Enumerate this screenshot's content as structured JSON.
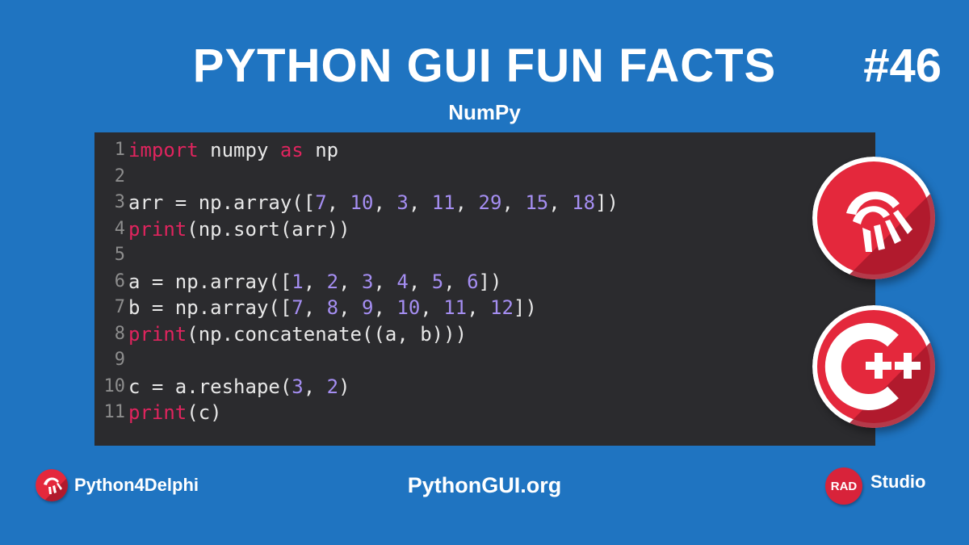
{
  "header": {
    "title": "PYTHON GUI FUN FACTS",
    "number": "#46",
    "subtitle": "NumPy"
  },
  "code": {
    "lines": [
      {
        "n": "1",
        "tokens": [
          [
            "kw",
            "import"
          ],
          [
            "t",
            " numpy "
          ],
          [
            "kw",
            "as"
          ],
          [
            "t",
            " np"
          ]
        ]
      },
      {
        "n": "2",
        "tokens": []
      },
      {
        "n": "3",
        "tokens": [
          [
            "t",
            "arr = np.array(["
          ],
          [
            "num",
            "7"
          ],
          [
            "t",
            ", "
          ],
          [
            "num",
            "10"
          ],
          [
            "t",
            ", "
          ],
          [
            "num",
            "3"
          ],
          [
            "t",
            ", "
          ],
          [
            "num",
            "11"
          ],
          [
            "t",
            ", "
          ],
          [
            "num",
            "29"
          ],
          [
            "t",
            ", "
          ],
          [
            "num",
            "15"
          ],
          [
            "t",
            ", "
          ],
          [
            "num",
            "18"
          ],
          [
            "t",
            "])"
          ]
        ]
      },
      {
        "n": "4",
        "tokens": [
          [
            "kw",
            "print"
          ],
          [
            "t",
            "(np.sort(arr))"
          ]
        ]
      },
      {
        "n": "5",
        "tokens": []
      },
      {
        "n": "6",
        "tokens": [
          [
            "t",
            "a = np.array(["
          ],
          [
            "num",
            "1"
          ],
          [
            "t",
            ", "
          ],
          [
            "num",
            "2"
          ],
          [
            "t",
            ", "
          ],
          [
            "num",
            "3"
          ],
          [
            "t",
            ", "
          ],
          [
            "num",
            "4"
          ],
          [
            "t",
            ", "
          ],
          [
            "num",
            "5"
          ],
          [
            "t",
            ", "
          ],
          [
            "num",
            "6"
          ],
          [
            "t",
            "])"
          ]
        ]
      },
      {
        "n": "7",
        "tokens": [
          [
            "t",
            "b = np.array(["
          ],
          [
            "num",
            "7"
          ],
          [
            "t",
            ", "
          ],
          [
            "num",
            "8"
          ],
          [
            "t",
            ", "
          ],
          [
            "num",
            "9"
          ],
          [
            "t",
            ", "
          ],
          [
            "num",
            "10"
          ],
          [
            "t",
            ", "
          ],
          [
            "num",
            "11"
          ],
          [
            "t",
            ", "
          ],
          [
            "num",
            "12"
          ],
          [
            "t",
            "])"
          ]
        ]
      },
      {
        "n": "8",
        "tokens": [
          [
            "kw",
            "print"
          ],
          [
            "t",
            "(np.concatenate((a, b)))"
          ]
        ]
      },
      {
        "n": "9",
        "tokens": []
      },
      {
        "n": "10",
        "tokens": [
          [
            "t",
            "c = a.reshape("
          ],
          [
            "num",
            "3"
          ],
          [
            "t",
            ", "
          ],
          [
            "num",
            "2"
          ],
          [
            "t",
            ")"
          ]
        ]
      },
      {
        "n": "11",
        "tokens": [
          [
            "kw",
            "print"
          ],
          [
            "t",
            "(c)"
          ]
        ]
      }
    ]
  },
  "logos": {
    "delphi": "delphi-helmet-icon",
    "cpp": "cpp-builder-icon"
  },
  "footer": {
    "left_label": "Python4Delphi",
    "center_label": "PythonGUI.org",
    "rad_badge": "RAD",
    "right_label": "Studio"
  },
  "colors": {
    "background": "#1f74c1",
    "code_bg": "#2b2b2e",
    "keyword": "#e0245e",
    "number": "#a58ef2",
    "brand_red": "#d8233a"
  }
}
